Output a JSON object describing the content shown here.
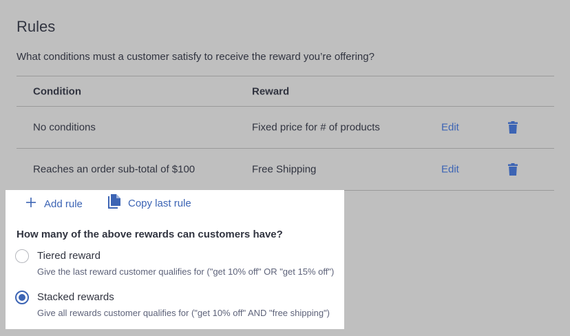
{
  "rules": {
    "title": "Rules",
    "question": "What conditions must a customer satisfy to receive the reward you’re offering?",
    "columns": {
      "condition": "Condition",
      "reward": "Reward"
    },
    "rows": [
      {
        "condition": "No conditions",
        "reward": "Fixed price for # of products",
        "edit": "Edit",
        "delete_icon": "trash-icon"
      },
      {
        "condition": "Reaches an order sub-total of $100",
        "reward": "Free Shipping",
        "edit": "Edit",
        "delete_icon": "trash-icon"
      }
    ]
  },
  "actions": {
    "add_rule": "Add rule",
    "add_icon": "plus-icon",
    "copy_last_rule": "Copy last rule",
    "copy_icon": "copy-icon"
  },
  "reward_mode": {
    "question": "How many of the above rewards can customers have?",
    "options": [
      {
        "label": "Tiered reward",
        "help": "Give the last reward customer qualifies for (\"get 10% off\" OR \"get 15% off\")",
        "selected": false
      },
      {
        "label": "Stacked rewards",
        "help": "Give all rewards customer qualifies for (\"get 10% off\" AND \"free shipping\")",
        "selected": true
      }
    ]
  },
  "colors": {
    "accent": "#3c64b4",
    "overlay": "#bfbfbf",
    "text": "#313440"
  }
}
